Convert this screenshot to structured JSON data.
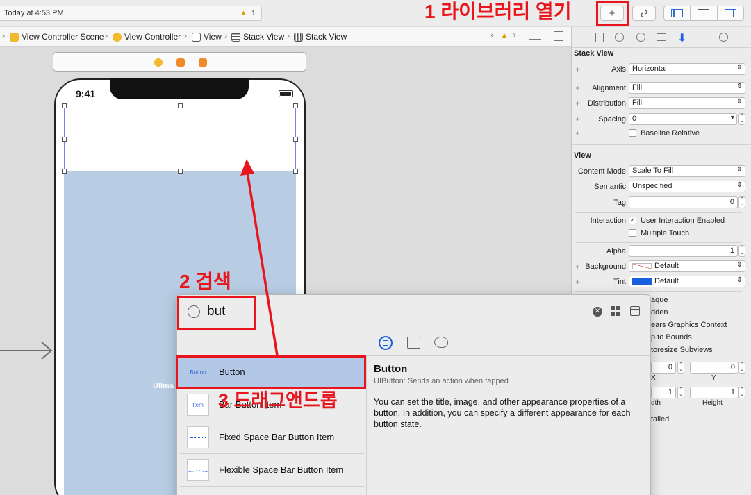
{
  "toolbar": {
    "status_text": "Today at 4:53 PM",
    "warning_count": "1",
    "library_label": "+",
    "swap_label": "⇄"
  },
  "annotations": {
    "step1": "1 라이브러리 열기",
    "step2": "2 검색",
    "step3": "3 드래그앤드롭",
    "color": "#e8161c"
  },
  "jumpbar": {
    "crumbs": [
      "View Controller Scene",
      "View Controller",
      "View",
      "Stack View",
      "Stack View"
    ]
  },
  "canvas": {
    "status_time": "9:41",
    "hidden_label": "UIIma"
  },
  "inspector": {
    "stack_view": {
      "title": "Stack View",
      "axis_label": "Axis",
      "axis_value": "Horizontal",
      "alignment_label": "Alignment",
      "alignment_value": "Fill",
      "distribution_label": "Distribution",
      "distribution_value": "Fill",
      "spacing_label": "Spacing",
      "spacing_value": "0",
      "baseline_label": "Baseline Relative"
    },
    "view": {
      "title": "View",
      "content_mode_label": "Content Mode",
      "content_mode_value": "Scale To Fill",
      "semantic_label": "Semantic",
      "semantic_value": "Unspecified",
      "tag_label": "Tag",
      "tag_value": "0",
      "interaction_label": "Interaction",
      "user_interaction_label": "User Interaction Enabled",
      "multiple_touch_label": "Multiple Touch",
      "alpha_label": "Alpha",
      "alpha_value": "1",
      "background_label": "Background",
      "background_value": "Default",
      "tint_label": "Tint",
      "tint_value": "Default",
      "tint_color": "#1a5fe0"
    },
    "drawing": {
      "opaque_partial": "aque",
      "hidden_partial": "dden",
      "clears_partial": "ears Graphics Context",
      "clip_partial": "p to Bounds",
      "autoresize_partial": "toresize Subviews"
    },
    "stretching": {
      "x_value": "0",
      "y_value": "0",
      "x_label": "X",
      "y_label": "Y",
      "width_value": "1",
      "height_value": "1",
      "width_partial": "dth",
      "height_label": "Height",
      "installed_partial": "talled"
    }
  },
  "library": {
    "search_value": "but",
    "items": [
      {
        "thumb": "Button",
        "name": "Button"
      },
      {
        "thumb": "Item",
        "name": "Bar Button Item"
      },
      {
        "thumb": "",
        "name": "Fixed Space Bar Button Item"
      },
      {
        "thumb": "",
        "name": "Flexible Space Bar Button Item"
      }
    ],
    "detail": {
      "title": "Button",
      "subtitle": "UIButton: Sends an action when tapped",
      "description": "You can set the title, image, and other appearance properties of a button. In addition, you can specify a different appearance for each button state."
    }
  }
}
